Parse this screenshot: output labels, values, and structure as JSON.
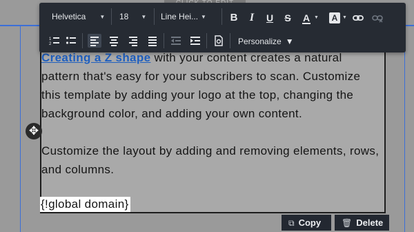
{
  "background": {
    "tab_label": "CLICK TO EDIT"
  },
  "toolbar": {
    "font_family": "Helvetica",
    "font_size": "18",
    "line_height": "Line Hei...",
    "bold_label": "B",
    "italic_label": "I",
    "underline_label": "U",
    "strikethrough_label": "S",
    "font_color_label": "A",
    "highlight_label": "A",
    "personalize_label": "Personalize",
    "icons": {
      "bold": "bold-icon",
      "italic": "italic-icon",
      "underline": "underline-icon",
      "strikethrough": "strikethrough-icon",
      "font_color": "font-color-icon",
      "highlight": "highlight-color-icon",
      "link": "link-icon",
      "unlink": "unlink-icon",
      "ordered_list": "ordered-list-icon",
      "unordered_list": "unordered-list-icon",
      "align_left": "align-left-icon",
      "align_center": "align-center-icon",
      "align_right": "align-right-icon",
      "align_justify": "align-justify-icon",
      "outdent": "outdent-icon",
      "indent": "indent-icon",
      "source": "source-code-icon"
    },
    "active_alignment": "left"
  },
  "content": {
    "link_text": "Creating a Z shape",
    "paragraph1_rest": " with your content creates a natural pattern that's easy for your subscribers to scan. Customize this template by adding your logo at the top, changing the background color, and adding your own content.",
    "paragraph2": "Customize the layout by adding and removing elements, rows, and columns.",
    "merge_tag": "{!global domain}"
  },
  "actions": {
    "copy_label": "Copy",
    "delete_label": "Delete"
  },
  "colors": {
    "toolbar_bg": "#262b33",
    "link": "#1f5fbf",
    "selection_guide": "#3b6fd8"
  }
}
